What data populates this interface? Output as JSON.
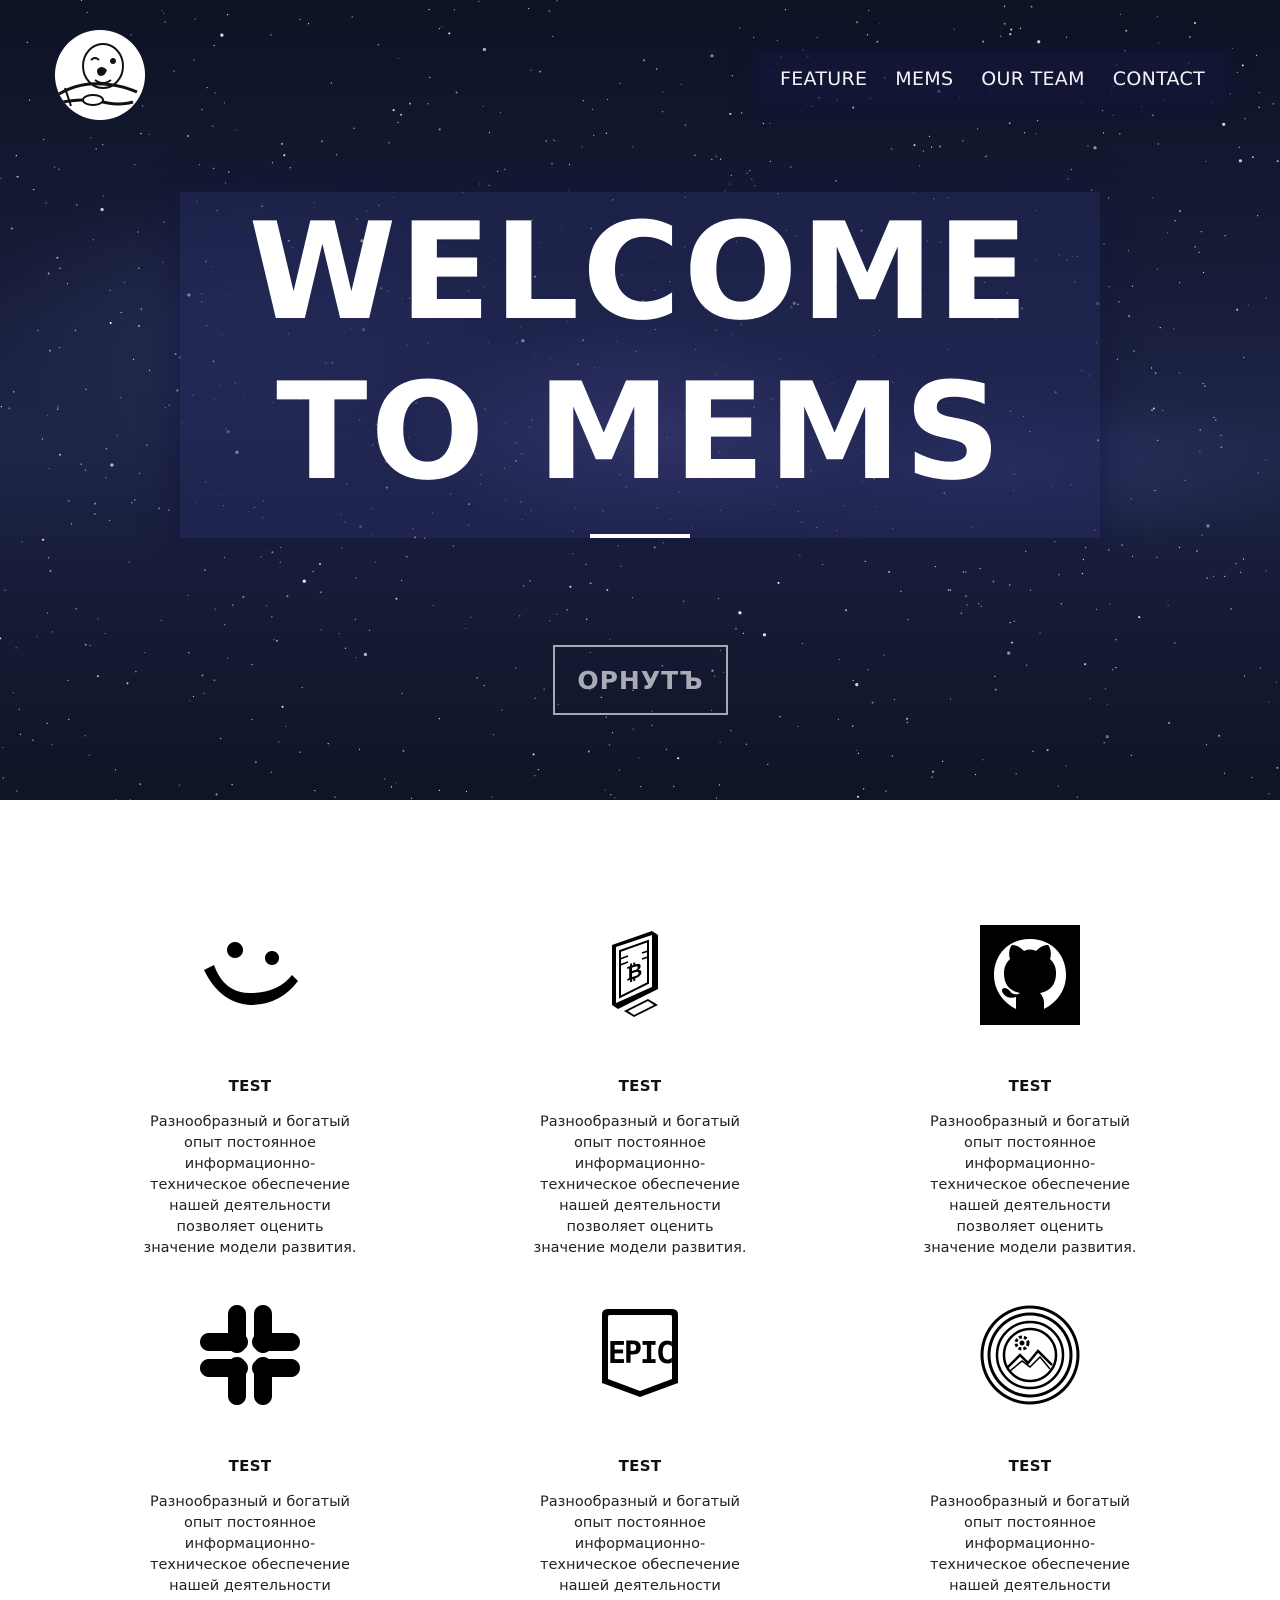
{
  "nav": {
    "items": [
      {
        "label": "FEATURE"
      },
      {
        "label": "MEMS"
      },
      {
        "label": "OUR TEAM"
      },
      {
        "label": "CONTACT"
      }
    ]
  },
  "hero": {
    "headline_line1": "WELCOME",
    "headline_line2": "TO MEMS",
    "cta_label": "ОРНУТЪ"
  },
  "features": {
    "items": [
      {
        "icon": "smile-icon",
        "title": "TEST",
        "text": "Разнообразный и богатый опыт постоянное информационно-техническое обеспечение нашей деятельности позволяет оценить значение модели развития."
      },
      {
        "icon": "bitcoin-monitor-icon",
        "title": "TEST",
        "text": "Разнообразный и богатый опыт постоянное информационно-техническое обеспечение нашей деятельности позволяет оценить значение модели развития."
      },
      {
        "icon": "github-icon",
        "title": "TEST",
        "text": "Разнообразный и богатый опыт постоянное информационно-техническое обеспечение нашей деятельности позволяет оценить значение модели развития."
      },
      {
        "icon": "slack-icon",
        "title": "TEST",
        "text": "Разнообразный и богатый опыт постоянное информационно-техническое обеспечение нашей деятельности позволяет оценить значение модели развития."
      },
      {
        "icon": "epic-games-icon",
        "title": "TEST",
        "text": "Разнообразный и богатый опыт постоянное информационно-техническое обеспечение нашей деятельности позволяет оценить значение модели развития."
      },
      {
        "icon": "gear-mountain-badge-icon",
        "title": "TEST",
        "text": "Разнообразный и богатый опыт постоянное информационно-техническое обеспечение нашей деятельности позволяет оценить значение модели развития."
      }
    ]
  },
  "colors": {
    "hero_background": "#171d38",
    "nav_background": "#14163a",
    "text_light": "#ffffff",
    "cta_border": "#a7a9b4",
    "text_dark": "#111111"
  }
}
